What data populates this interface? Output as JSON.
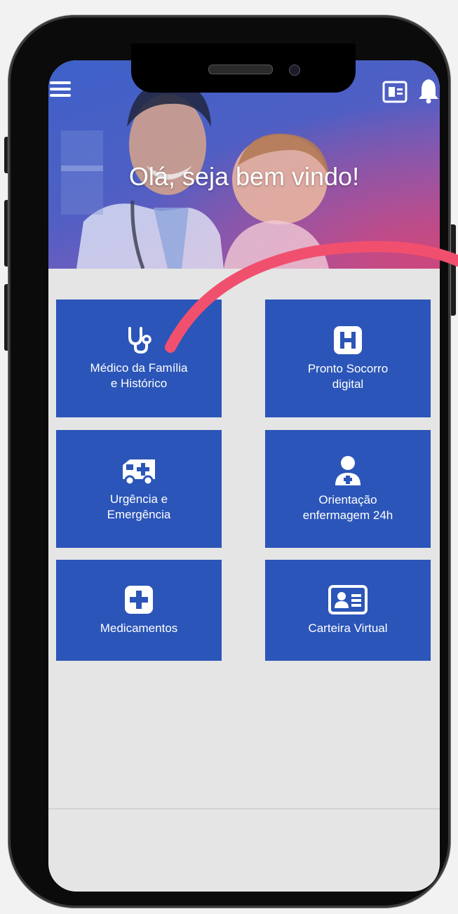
{
  "header": {
    "greeting": "Olá, seja bem vindo!",
    "menu_icon": "hamburger-menu-icon",
    "card_icon": "id-card-icon",
    "bell_icon": "bell-icon"
  },
  "tiles": [
    {
      "label_line1": "Médico da Família",
      "label_line2": "e Histórico",
      "icon": "stethoscope-icon"
    },
    {
      "label_line1": "Pronto Socorro",
      "label_line2": "digital",
      "icon": "hospital-icon"
    },
    {
      "label_line1": "Urgência e",
      "label_line2": "Emergência",
      "icon": "ambulance-icon"
    },
    {
      "label_line1": "Orientação",
      "label_line2": "enfermagem 24h",
      "icon": "nurse-icon"
    },
    {
      "label_line1": "Medicamentos",
      "label_line2": "",
      "icon": "medical-cross-icon"
    },
    {
      "label_line1": "Carteira Virtual",
      "label_line2": "",
      "icon": "virtual-card-icon"
    }
  ],
  "colors": {
    "tile_blue": "#2b55b8",
    "hero_blue": "#3d61c8",
    "hero_pink": "#d2467a",
    "annotation_arc": "#f0506e",
    "screen_bg": "#e5e5e5"
  }
}
